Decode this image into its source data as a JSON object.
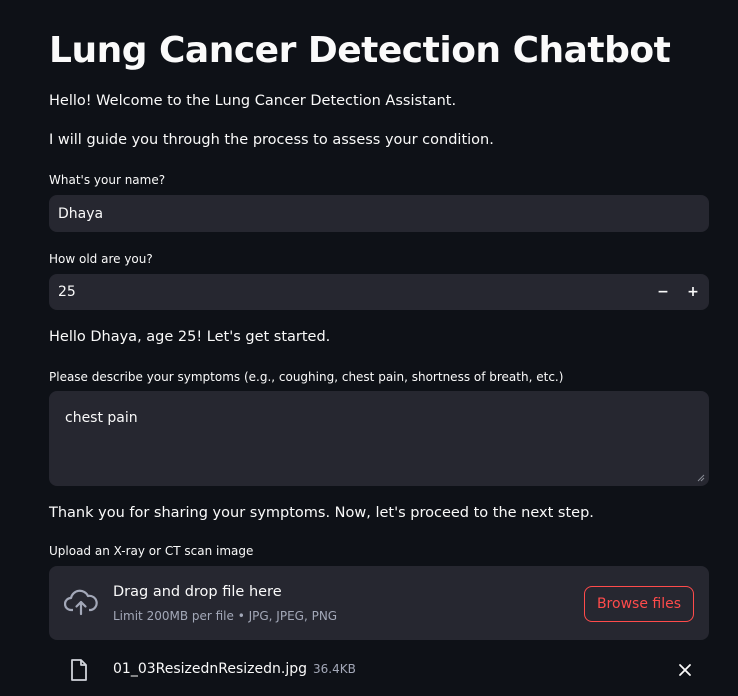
{
  "page": {
    "title": "Lung Cancer Detection Chatbot",
    "welcome": "Hello! Welcome to the Lung Cancer Detection Assistant.",
    "guide": "I will guide you through the process to assess your condition."
  },
  "name_field": {
    "label": "What's your name?",
    "value": "Dhaya"
  },
  "age_field": {
    "label": "How old are you?",
    "value": "25",
    "decrement": "−",
    "increment": "+"
  },
  "greeting": "Hello Dhaya, age 25! Let's get started.",
  "symptoms_field": {
    "label": "Please describe your symptoms (e.g., coughing, chest pain, shortness of breath, etc.)",
    "value": "chest pain"
  },
  "thanks": "Thank you for sharing your symptoms. Now, let's proceed to the next step.",
  "uploader": {
    "label": "Upload an X-ray or CT scan image",
    "drop_title": "Drag and drop file here",
    "drop_hint": "Limit 200MB per file • JPG, JPEG, PNG",
    "browse_label": "Browse files",
    "icon": "cloud-upload-icon"
  },
  "uploaded_file": {
    "name": "01_03ResizednResizedn.jpg",
    "size": "36.4KB",
    "icon": "file-icon"
  },
  "colors": {
    "background": "#0e1117",
    "input_bg": "#262730",
    "accent": "#ff4b4b",
    "muted_text": "#a3a8b8"
  }
}
